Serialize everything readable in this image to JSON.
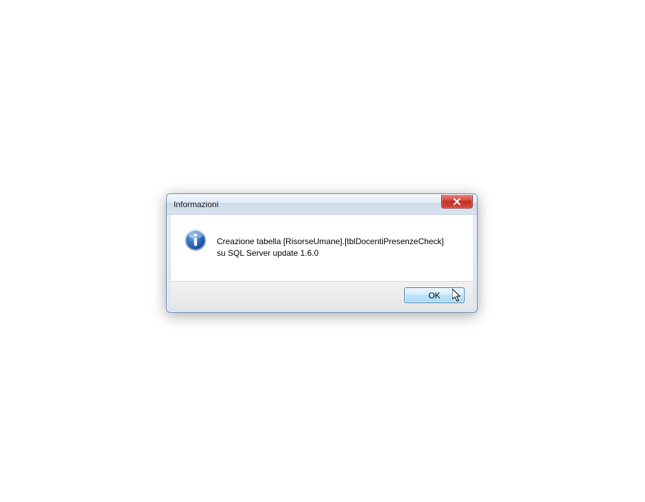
{
  "dialog": {
    "title": "Informazioni",
    "message": "Creazione tabella [RisorseUmane].[tblDocentiPresenzeCheck]\nsu SQL Server update 1.6.0",
    "buttons": {
      "ok": "OK"
    }
  }
}
